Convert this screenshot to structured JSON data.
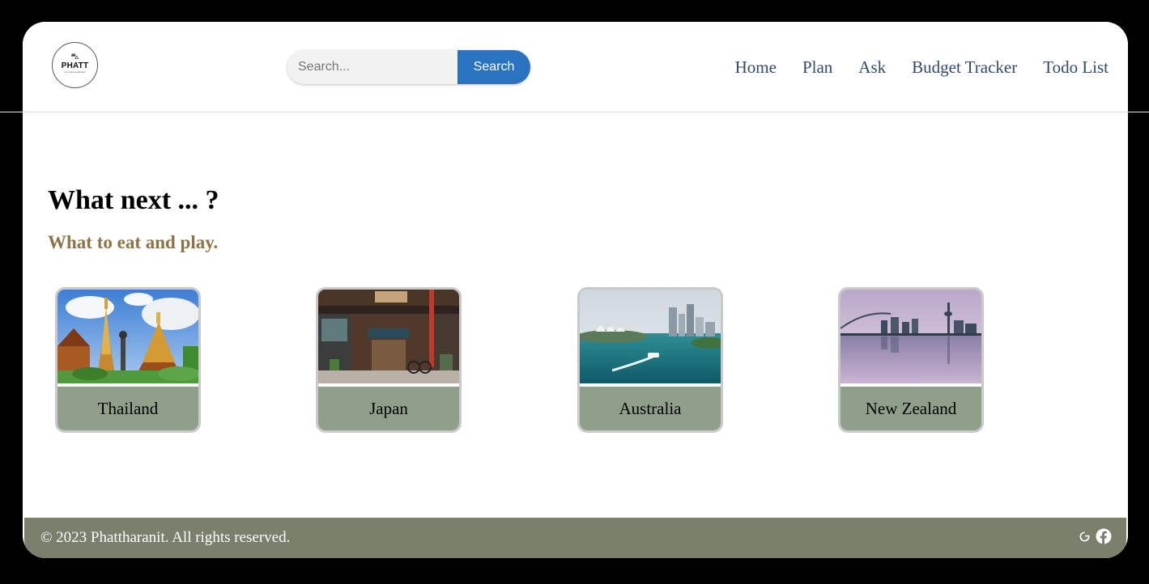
{
  "header": {
    "logo": {
      "brand": "PHATT",
      "tagline": "your travel assistant"
    },
    "search": {
      "placeholder": "Search...",
      "button_label": "Search"
    },
    "nav": [
      {
        "label": "Home"
      },
      {
        "label": "Plan"
      },
      {
        "label": "Ask"
      },
      {
        "label": "Budget Tracker"
      },
      {
        "label": "Todo List"
      }
    ]
  },
  "main": {
    "title": "What next ... ?",
    "subtitle": "What to eat and play.",
    "destinations": [
      {
        "name": "Thailand",
        "image": "thai-temple-photo"
      },
      {
        "name": "Japan",
        "image": "japanese-storefront-photo"
      },
      {
        "name": "Australia",
        "image": "sydney-harbour-photo"
      },
      {
        "name": "New Zealand",
        "image": "auckland-skyline-photo"
      }
    ]
  },
  "footer": {
    "copyright": "© 2023 Phattharanit. All rights reserved.",
    "icons": [
      "google-icon",
      "facebook-icon"
    ]
  },
  "colors": {
    "search_button": "#2a73c0",
    "nav_text": "#354a66",
    "subtitle": "#8d7446",
    "card_label_bg": "#8f9f89",
    "footer_bg": "#7a806c"
  }
}
